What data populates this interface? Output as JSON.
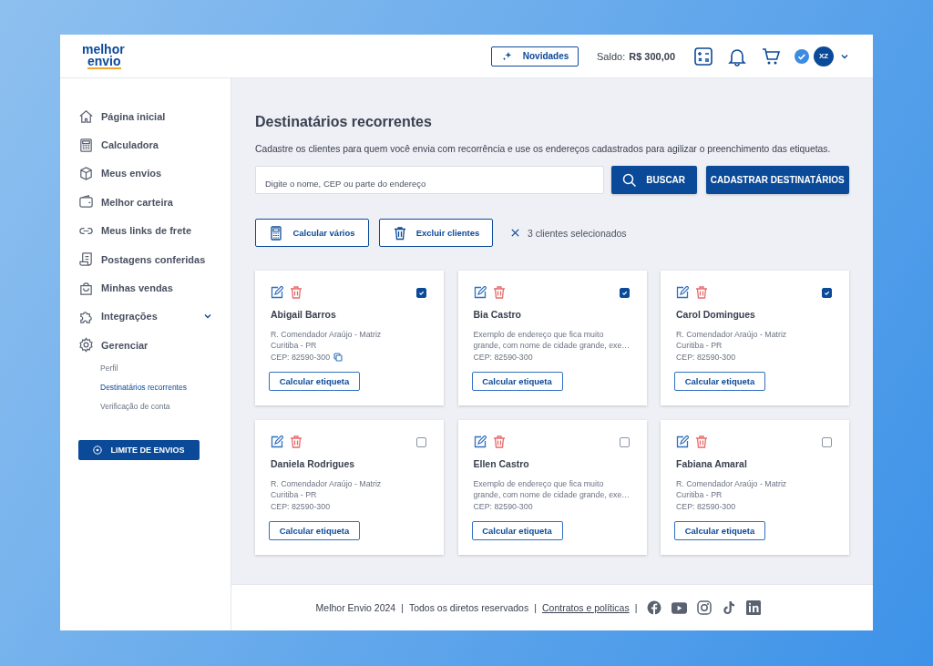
{
  "header": {
    "logo": [
      "melhor",
      "envio"
    ],
    "news_button": "Novidades",
    "balance_label": "Saldo:",
    "balance_value": "R$ 300,00",
    "avatar": "XZ"
  },
  "sidebar": {
    "items": [
      {
        "label": "Página inicial",
        "expandable": false,
        "selected": false
      },
      {
        "label": "Calculadora",
        "expandable": false,
        "selected": false
      },
      {
        "label": "Meus envios",
        "expandable": false,
        "selected": false
      },
      {
        "label": "Melhor carteira",
        "expandable": false,
        "selected": false
      },
      {
        "label": "Meus links de frete",
        "expandable": false,
        "selected": false
      },
      {
        "label": "Postagens conferidas",
        "expandable": false,
        "selected": false
      },
      {
        "label": "Minhas vendas",
        "expandable": false,
        "selected": false
      },
      {
        "label": "Integrações",
        "expandable": true,
        "selected": false
      },
      {
        "label": "Gerenciar",
        "expandable": false,
        "selected": false,
        "children": [
          {
            "label": "Perfil",
            "selected": false
          },
          {
            "label": "Destinatários recorrentes",
            "selected": true
          },
          {
            "label": "Verificação de conta",
            "selected": false
          }
        ]
      }
    ],
    "limit_button": "LIMITE DE ENVIOS"
  },
  "page": {
    "title": "Destinatários recorrentes",
    "description": "Cadastre os clientes para quem você envia com recorrência e use os endereços cadastrados para agilizar o preenchimento das etiquetas.",
    "search": {
      "placeholder": "Digite o nome, CEP ou parte do endereço"
    },
    "search_button": "BUSCAR",
    "register_button": "CADASTRAR DESTINATÁRIOS",
    "calc_many_button": "Calcular vários",
    "delete_button": "Excluir clientes",
    "selection_count": "3 clientes selecionados",
    "cards": [
      {
        "name": "Abigail Barros",
        "address": [
          "R. Comendador Araújo - Matriz",
          "Curitiba - PR"
        ],
        "cep": "CEP: 82590-300",
        "copyable": true,
        "checked": true,
        "button": "Calcular etiqueta"
      },
      {
        "name": "Bia Castro",
        "address": [
          "Exemplo de endereço que fica muito",
          "grande, com nome de cidade grande, exe…"
        ],
        "cep": "CEP: 82590-300",
        "copyable": false,
        "checked": true,
        "button": "Calcular etiqueta"
      },
      {
        "name": "Carol Domingues",
        "address": [
          "R. Comendador Araújo - Matriz",
          "Curitiba - PR"
        ],
        "cep": "CEP: 82590-300",
        "copyable": false,
        "checked": true,
        "button": "Calcular etiqueta"
      },
      {
        "name": "Daniela Rodrigues",
        "address": [
          "R. Comendador Araújo - Matriz",
          "Curitiba - PR"
        ],
        "cep": "CEP: 82590-300",
        "copyable": false,
        "checked": false,
        "button": "Calcular etiqueta"
      },
      {
        "name": "Ellen Castro",
        "address": [
          "Exemplo de endereço que fica muito",
          "grande, com nome de cidade grande, exe…"
        ],
        "cep": "CEP: 82590-300",
        "copyable": false,
        "checked": false,
        "button": "Calcular etiqueta"
      },
      {
        "name": "Fabiana Amaral",
        "address": [
          "R. Comendador Araújo - Matriz",
          "Curitiba - PR"
        ],
        "cep": "CEP: 82590-300",
        "copyable": false,
        "checked": false,
        "button": "Calcular etiqueta"
      }
    ]
  },
  "footer": {
    "texts": [
      "Melhor Envio 2024",
      "|",
      "Todos os diretos reservados",
      "|"
    ],
    "link": "Contratos e políticas",
    "separator": "|"
  }
}
